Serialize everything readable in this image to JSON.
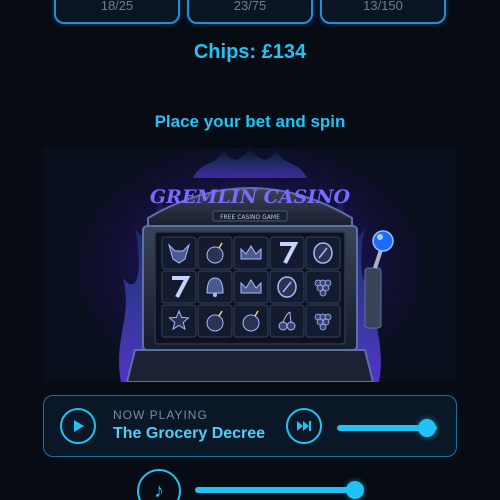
{
  "stats": [
    {
      "value": "18/25"
    },
    {
      "value": "23/75"
    },
    {
      "value": "13/150"
    }
  ],
  "chips_text": "Chips: £134",
  "prompt_text": "Place your bet and spin",
  "machine": {
    "title": "GREMLIN CASINO",
    "subtitle": "FREE CASINO GAME",
    "reels": [
      [
        "gremlin-mask",
        "bomb",
        "crown",
        "seven",
        "coin"
      ],
      [
        "seven",
        "bell",
        "crown",
        "coin",
        "grapes"
      ],
      [
        "star",
        "bomb",
        "bomb",
        "cherries",
        "grapes"
      ]
    ]
  },
  "player": {
    "label": "NOW PLAYING",
    "track": "The Grocery Decree",
    "volume": 0.9
  },
  "music_volume": 1.0,
  "colors": {
    "accent": "#1fc3f5",
    "background": "#060b14",
    "border": "#1f8fd6"
  }
}
